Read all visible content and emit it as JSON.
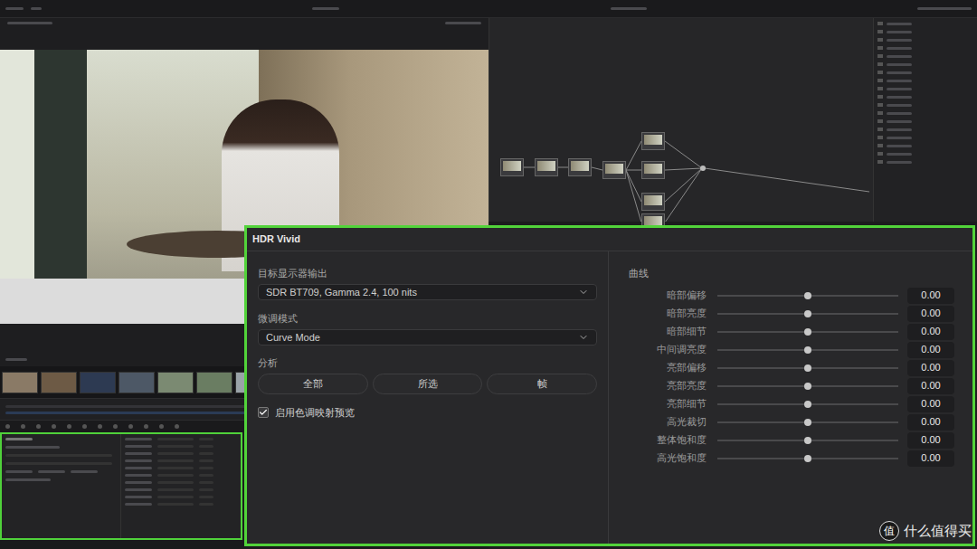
{
  "panel": {
    "title": "HDR Vivid",
    "target_output": {
      "label": "目标显示器输出",
      "value": "SDR BT709, Gamma 2.4, 100 nits"
    },
    "tuning_mode": {
      "label": "微调模式",
      "value": "Curve Mode"
    },
    "analysis": {
      "label": "分析",
      "buttons": [
        "全部",
        "所选",
        "帧"
      ]
    },
    "preview": {
      "label": "启用色调映射预览",
      "checked": true
    },
    "curves": {
      "label": "曲线",
      "sliders": [
        {
          "label": "暗部偏移",
          "level": 0.5,
          "value": "0.00"
        },
        {
          "label": "暗部亮度",
          "level": 0.5,
          "value": "0.00"
        },
        {
          "label": "暗部细节",
          "level": 0.5,
          "value": "0.00"
        },
        {
          "label": "中间调亮度",
          "level": 0.5,
          "value": "0.00"
        },
        {
          "label": "亮部偏移",
          "level": 0.5,
          "value": "0.00"
        },
        {
          "label": "亮部亮度",
          "level": 0.5,
          "value": "0.00"
        },
        {
          "label": "亮部细节",
          "level": 0.5,
          "value": "0.00"
        },
        {
          "label": "高光裁切",
          "level": 0.5,
          "value": "0.00"
        },
        {
          "label": "整体饱和度",
          "level": 0.5,
          "value": "0.00"
        },
        {
          "label": "高光饱和度",
          "level": 0.5,
          "value": "0.00"
        }
      ]
    }
  },
  "watermark": {
    "logo": "值",
    "text": "什么值得买"
  }
}
